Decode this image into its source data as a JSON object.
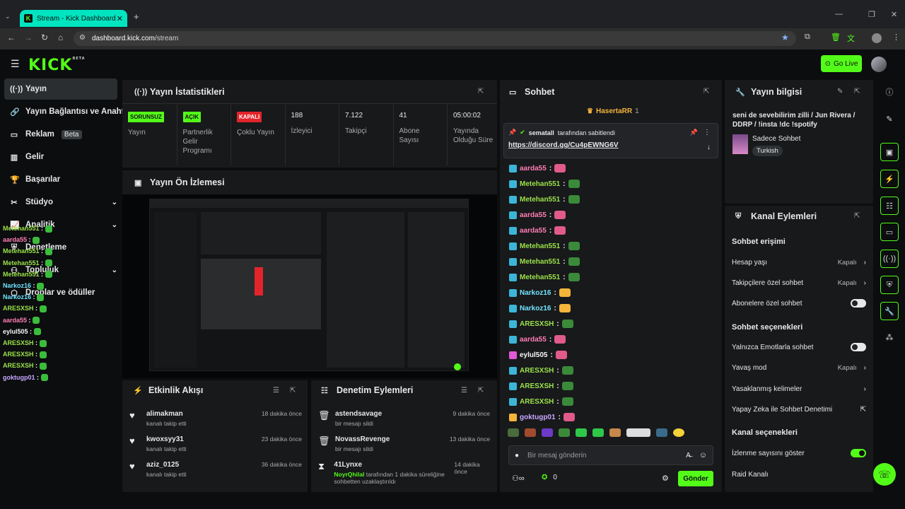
{
  "browser": {
    "tab_title": "Stream - Kick Dashboard",
    "url_host": "dashboard.kick.com",
    "url_path": "/stream"
  },
  "header": {
    "logo": "KICK",
    "logo_badge": "BETA",
    "go_live": "Go Live"
  },
  "sidebar": [
    {
      "label": "Yayın",
      "icon": "broadcast-icon"
    },
    {
      "label": "Yayın Bağlantısı ve Anahtarı",
      "icon": "link-icon"
    },
    {
      "label": "Reklam",
      "icon": "ad-icon",
      "badge": "Beta"
    },
    {
      "label": "Gelir",
      "icon": "revenue-icon"
    },
    {
      "label": "Başarılar",
      "icon": "trophy-icon"
    },
    {
      "label": "Stüdyo",
      "icon": "studio-icon"
    },
    {
      "label": "Analitik",
      "icon": "analytics-icon"
    },
    {
      "label": "Denetleme",
      "icon": "moderation-icon"
    },
    {
      "label": "Topluluk",
      "icon": "community-icon"
    },
    {
      "label": "Droplar ve ödüller",
      "icon": "drops-icon"
    }
  ],
  "overlay_chat": [
    {
      "user": "Metehan551",
      "color": "#9be24a"
    },
    {
      "user": "aarda55",
      "color": "#ff7eb6"
    },
    {
      "user": "Metehan551",
      "color": "#9be24a"
    },
    {
      "user": "Metehan551",
      "color": "#9be24a"
    },
    {
      "user": "Metehan551",
      "color": "#9be24a"
    },
    {
      "user": "Narkoz16",
      "color": "#6fe3ff"
    },
    {
      "user": "Narkoz16",
      "color": "#6fe3ff"
    },
    {
      "user": "ARESXSH",
      "color": "#9be24a"
    },
    {
      "user": "aarda55",
      "color": "#ff7eb6"
    },
    {
      "user": "eylul505",
      "color": "#f7f7f7"
    },
    {
      "user": "ARESXSH",
      "color": "#9be24a"
    },
    {
      "user": "ARESXSH",
      "color": "#9be24a"
    },
    {
      "user": "ARESXSH",
      "color": "#9be24a"
    },
    {
      "user": "goktugp01",
      "color": "#c7a6ff"
    }
  ],
  "stats": {
    "title": "Yayın İstatistikleri",
    "items": [
      {
        "badge": "SORUNSUZ",
        "badge_color": "#53fc18",
        "label": "Yayın"
      },
      {
        "badge": "AÇIK",
        "badge_color": "#53fc18",
        "label": "Partnerlik Gelir Programı"
      },
      {
        "badge": "KAPALI",
        "badge_color": "#e3242b",
        "label": "Çoklu Yayın"
      },
      {
        "value": "188",
        "label": "İzleyici"
      },
      {
        "value": "7.122",
        "label": "Takipçi"
      },
      {
        "value": "41",
        "label": "Abone Sayısı"
      },
      {
        "value": "05:00:02",
        "label": "Yayında Olduğu Süre"
      }
    ]
  },
  "preview": {
    "title": "Yayın Ön İzlemesi"
  },
  "activity": {
    "title": "Etkinlik Akışı",
    "rows": [
      {
        "name": "alimakman",
        "sub": "kanalı takip etti",
        "time": "18 dakika önce"
      },
      {
        "name": "kwoxsyy31",
        "sub": "kanalı takip etti",
        "time": "23 dakika önce"
      },
      {
        "name": "aziz_0125",
        "sub": "kanalı takip etti",
        "time": "36 dakika önce"
      }
    ]
  },
  "modlog": {
    "title": "Denetim Eylemleri",
    "rows": [
      {
        "name": "astendsavage",
        "sub": "bir mesajı sildi",
        "time": "9 dakika önce",
        "icon": "trash-icon"
      },
      {
        "name": "NovassRevenge",
        "sub": "bir mesajı sildi",
        "time": "13 dakika önce",
        "icon": "trash-icon"
      },
      {
        "name": "41Lynxe",
        "sub_user": "NoyrQhilal",
        "sub": "tarafından 1 dakika süreliğine sohbetten uzaklaştırıldı",
        "time": "14 dakika önce",
        "icon": "hourglass-icon"
      }
    ]
  },
  "chat": {
    "title": "Sohbet",
    "top_gifter": "HasertaRR",
    "top_gifter_count": "1",
    "pinned_by": "sematall",
    "pinned_by_text": "tarafından sabitlendi",
    "pinned_link": "https://discord.gg/Cu4pEWNG6V",
    "messages": [
      {
        "user": "aarda55",
        "color": "#ff7eb6"
      },
      {
        "user": "Metehan551",
        "color": "#9be24a"
      },
      {
        "user": "Metehan551",
        "color": "#9be24a"
      },
      {
        "user": "aarda55",
        "color": "#ff7eb6"
      },
      {
        "user": "aarda55",
        "color": "#ff7eb6"
      },
      {
        "user": "Metehan551",
        "color": "#9be24a"
      },
      {
        "user": "Metehan551",
        "color": "#9be24a"
      },
      {
        "user": "Metehan551",
        "color": "#9be24a"
      },
      {
        "user": "Narkoz16",
        "color": "#6fe3ff"
      },
      {
        "user": "Narkoz16",
        "color": "#6fe3ff"
      },
      {
        "user": "ARESXSH",
        "color": "#9be24a"
      },
      {
        "user": "aarda55",
        "color": "#ff7eb6"
      },
      {
        "user": "eylul505",
        "color": "#f7f7f7"
      },
      {
        "user": "ARESXSH",
        "color": "#9be24a"
      },
      {
        "user": "ARESXSH",
        "color": "#9be24a"
      },
      {
        "user": "ARESXSH",
        "color": "#9be24a"
      },
      {
        "user": "goktugp01",
        "color": "#c7a6ff"
      }
    ],
    "input_placeholder": "Bir mesaj gönderin",
    "points": "0",
    "send": "Gönder"
  },
  "info": {
    "title": "Yayın bilgisi",
    "stream_title": "seni de sevebilirim zilli / Jun Rivera / DDRP / !insta !dc !spotify",
    "category": "Sadece Sohbet",
    "tag": "Turkish"
  },
  "channel": {
    "title": "Kanal Eylemleri",
    "chat_access": "Sohbet erişimi",
    "account_age": "Hesap yaşı",
    "account_age_val": "Kapalı",
    "followers_only": "Takipçilere özel sohbet",
    "followers_only_val": "Kapalı",
    "subs_only": "Abonelere özel sohbet",
    "chat_options": "Sohbet seçenekleri",
    "emote_only": "Yalnızca Emotlarla sohbet",
    "slow_mode": "Yavaş mod",
    "slow_mode_val": "Kapalı",
    "banned_words": "Yasaklanmış kelimeler",
    "ai_mod": "Yapay Zeka ile Sohbet Denetimi",
    "channel_options": "Kanal seçenekleri",
    "show_viewers": "İzlenme sayısını göster",
    "raid": "Raid Kanalı"
  },
  "colors": {
    "accent": "#53fc18",
    "danger": "#e3242b"
  }
}
